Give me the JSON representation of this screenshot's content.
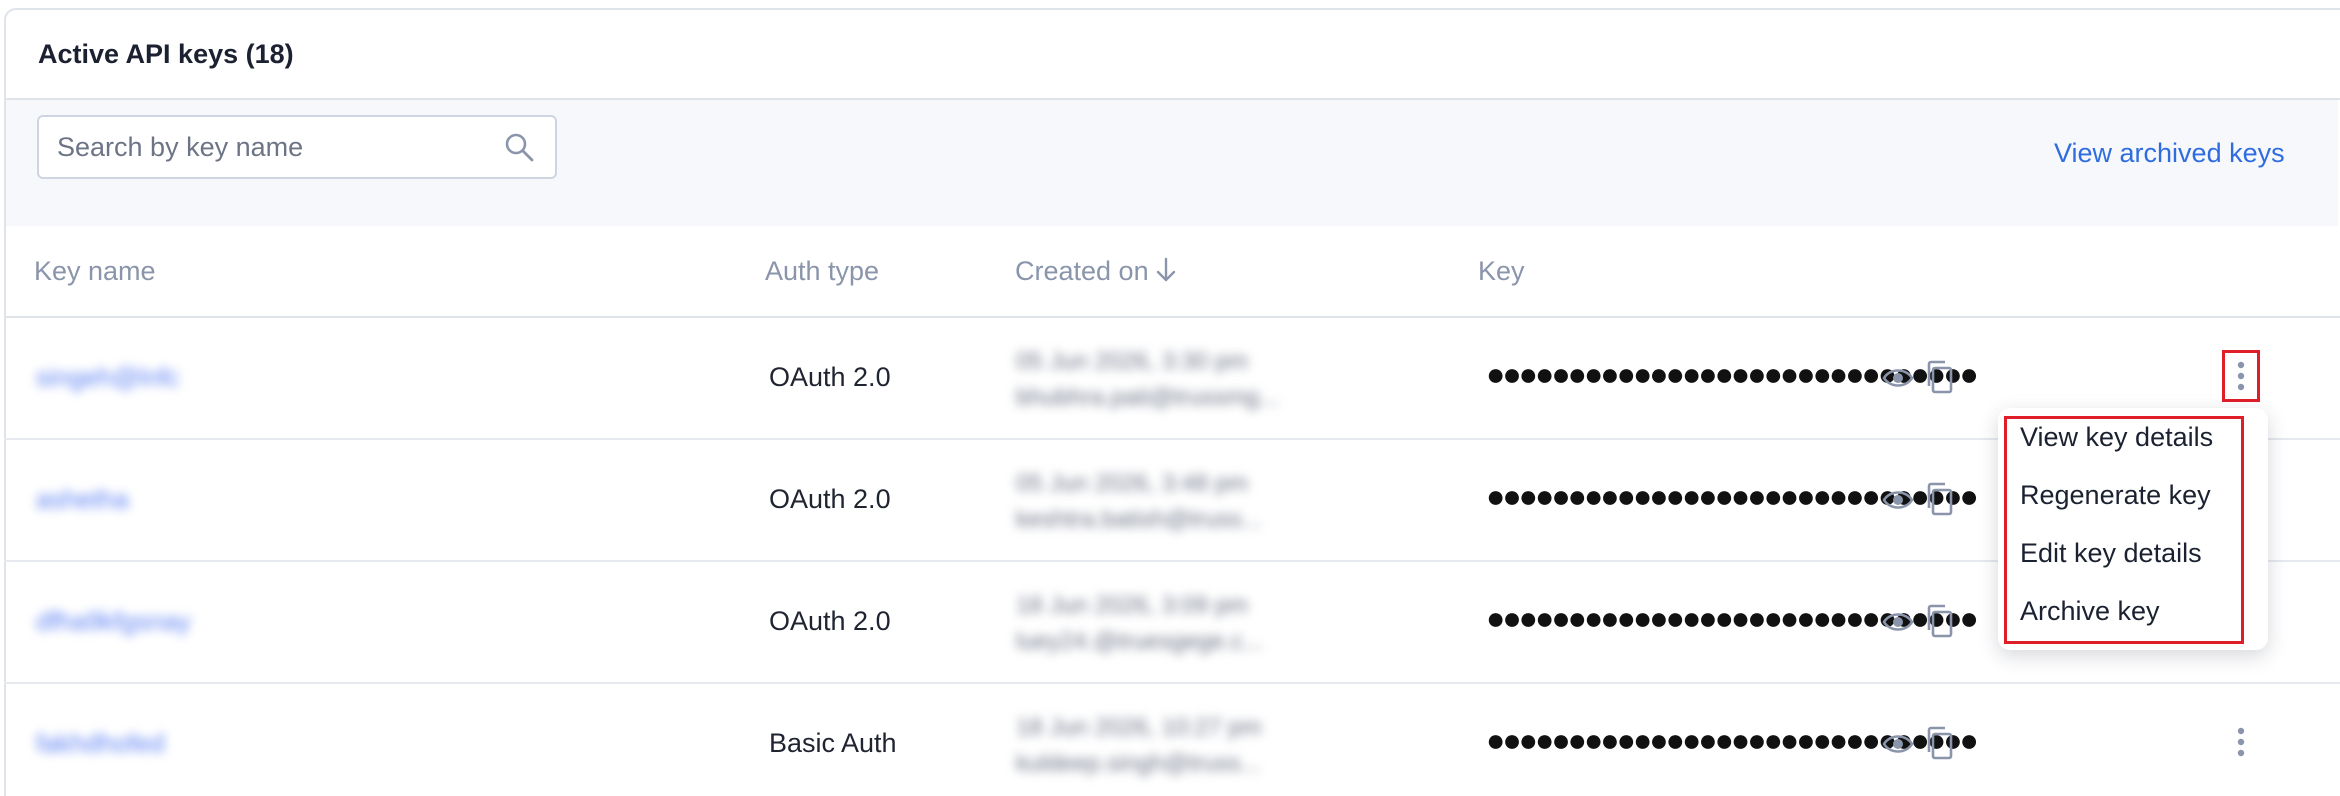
{
  "panel": {
    "title": "Active API keys (18)"
  },
  "toolbar": {
    "search_placeholder": "Search by key name",
    "archived_link": "View archived keys"
  },
  "table": {
    "columns": [
      "Key name",
      "Auth type",
      "Created on",
      "Key"
    ],
    "sort_icon": "arrow-down-icon",
    "rows": [
      {
        "key_name": "singeh@lnfc",
        "auth_type": "OAuth 2.0",
        "created_line1": "05 Jun 2026, 3:30 pm",
        "created_line2": "bhubhra.pati@trussmg...",
        "key_masked": "●●●●●●●●●●●●●●●●●●●●●●●●●●●●●●"
      },
      {
        "key_name": "ashetha",
        "auth_type": "OAuth 2.0",
        "created_line1": "05 Jun 2026, 3:48 pm",
        "created_line2": "keshtra.batish@truss...",
        "key_masked": "●●●●●●●●●●●●●●●●●●●●●●●●●●●●●●"
      },
      {
        "key_name": "dfha9kfgsnay",
        "auth_type": "OAuth 2.0",
        "created_line1": "18 Jun 2026, 3:09 pm",
        "created_line2": "luey24.@truesgege.c...",
        "key_masked": "●●●●●●●●●●●●●●●●●●●●●●●●●●●●●●"
      },
      {
        "key_name": "fakhdhofed",
        "auth_type": "Basic Auth",
        "created_line1": "18 Jun 2026, 10:27 pm",
        "created_line2": "kuldeep.singh@truss...",
        "key_masked": "●●●●●●●●●●●●●●●●●●●●●●●●●●●●●●"
      }
    ]
  },
  "menu": {
    "items": [
      "View key details",
      "Regenerate key",
      "Edit key details",
      "Archive key"
    ]
  },
  "colors": {
    "accent_link": "#2f6ce0",
    "highlight_red": "#e01e2a",
    "toolbar_bg": "#f6f8fc"
  }
}
